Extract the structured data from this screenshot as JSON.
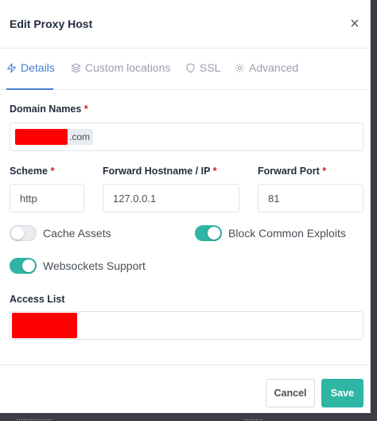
{
  "modal": {
    "title": "Edit Proxy Host",
    "close_glyph": "×"
  },
  "tabs": [
    {
      "label": "Details",
      "icon": "zap-icon",
      "active": true
    },
    {
      "label": "Custom locations",
      "icon": "layers-icon",
      "active": false
    },
    {
      "label": "SSL",
      "icon": "shield-icon",
      "active": false
    },
    {
      "label": "Advanced",
      "icon": "gear-icon",
      "active": false
    }
  ],
  "form": {
    "domain_names": {
      "label": "Domain Names",
      "required_mark": "*",
      "chip_suffix": ".com"
    },
    "scheme": {
      "label": "Scheme",
      "required_mark": "*",
      "value": "http"
    },
    "forward_hostname": {
      "label": "Forward Hostname / IP",
      "required_mark": "*",
      "value": "127.0.0.1"
    },
    "forward_port": {
      "label": "Forward Port",
      "required_mark": "*",
      "value": "81"
    },
    "toggles": {
      "cache_assets": {
        "label": "Cache Assets",
        "on": false
      },
      "block_common_exploits": {
        "label": "Block Common Exploits",
        "on": true
      },
      "websockets_support": {
        "label": "Websockets Support",
        "on": true
      }
    },
    "access_list": {
      "label": "Access List"
    }
  },
  "footer": {
    "cancel_label": "Cancel",
    "save_label": "Save"
  },
  "background": {
    "left_text": "...............",
    "right_text": "........"
  },
  "colors": {
    "accent": "#467fcf",
    "toggle_on": "#2fb5a4",
    "save_button": "#2fb5a4",
    "required": "#cd201f",
    "redaction": "#ff0000"
  }
}
